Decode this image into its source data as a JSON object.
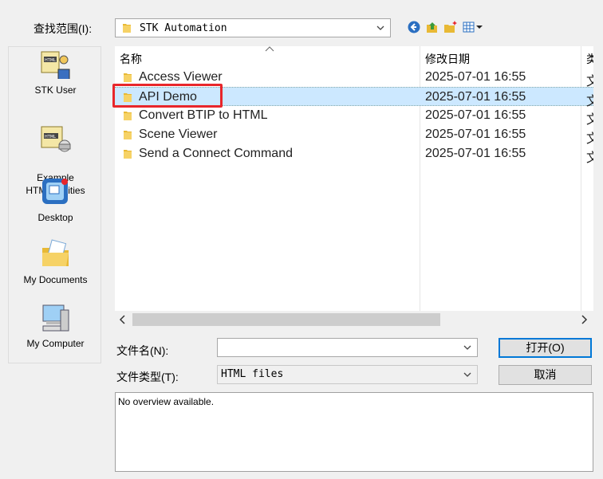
{
  "look_in": {
    "label": "查找范围(I):",
    "value": "STK Automation"
  },
  "toolbar": {
    "back_icon": "back-arrow-icon",
    "up_icon": "up-folder-icon",
    "new_folder_icon": "new-folder-icon",
    "view_icon": "view-menu-icon"
  },
  "places": [
    {
      "label": "STK User",
      "icon": "html-user-icon"
    },
    {
      "label": "Example\nHTML Utilities",
      "icon": "html-utilities-icon"
    },
    {
      "label": "Desktop",
      "icon": "desktop-icon"
    },
    {
      "label": "My Documents",
      "icon": "my-documents-icon"
    },
    {
      "label": "My Computer",
      "icon": "my-computer-icon"
    }
  ],
  "file_list": {
    "columns": [
      "名称",
      "修改日期",
      "类"
    ],
    "rows": [
      {
        "name": "Access Viewer",
        "date": "2025-07-01 16:55",
        "type": "文"
      },
      {
        "name": "API Demo",
        "date": "2025-07-01 16:55",
        "type": "文",
        "selected": true
      },
      {
        "name": "Convert BTIP to HTML",
        "date": "2025-07-01 16:55",
        "type": "文"
      },
      {
        "name": "Scene Viewer",
        "date": "2025-07-01 16:55",
        "type": "文"
      },
      {
        "name": "Send a Connect Command",
        "date": "2025-07-01 16:55",
        "type": "文"
      }
    ]
  },
  "filename": {
    "label": "文件名(N):",
    "value": ""
  },
  "filetype": {
    "label": "文件类型(T):",
    "value": "HTML files"
  },
  "buttons": {
    "open": "打开(O)",
    "cancel": "取消"
  },
  "overview": {
    "text": "No overview available."
  },
  "colors": {
    "selection": "#cce8ff",
    "highlight_box": "#e8262b",
    "default_button_border": "#0078d7"
  }
}
